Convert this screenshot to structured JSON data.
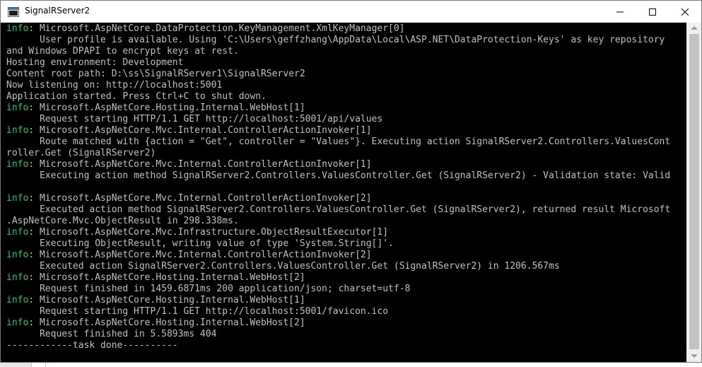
{
  "window": {
    "title": "SignalRServer2"
  },
  "icons": {
    "app": "console-app-icon",
    "minimize": "minimize-icon",
    "maximize": "maximize-icon",
    "close": "close-icon"
  },
  "colors": {
    "console_background": "#000000",
    "console_text": "#c0c0c0",
    "info_level": "#00d36b"
  },
  "console": {
    "lines": [
      {
        "level": "info",
        "text": ": Microsoft.AspNetCore.DataProtection.KeyManagement.XmlKeyManager[0]"
      },
      {
        "level": "",
        "text": "      User profile is available. Using 'C:\\Users\\geffzhang\\AppData\\Local\\ASP.NET\\DataProtection-Keys' as key repository"
      },
      {
        "level": "",
        "text": "and Windows DPAPI to encrypt keys at rest."
      },
      {
        "level": "",
        "text": "Hosting environment: Development"
      },
      {
        "level": "",
        "text": "Content root path: D:\\ss\\SignalRServer1\\SignalRServer2"
      },
      {
        "level": "",
        "text": "Now listening on: http://localhost:5001"
      },
      {
        "level": "",
        "text": "Application started. Press Ctrl+C to shut down."
      },
      {
        "level": "info",
        "text": ": Microsoft.AspNetCore.Hosting.Internal.WebHost[1]"
      },
      {
        "level": "",
        "text": "      Request starting HTTP/1.1 GET http://localhost:5001/api/values"
      },
      {
        "level": "info",
        "text": ": Microsoft.AspNetCore.Mvc.Internal.ControllerActionInvoker[1]"
      },
      {
        "level": "",
        "text": "      Route matched with {action = \"Get\", controller = \"Values\"}. Executing action SignalRServer2.Controllers.ValuesCont"
      },
      {
        "level": "",
        "text": "roller.Get (SignalRServer2)"
      },
      {
        "level": "info",
        "text": ": Microsoft.AspNetCore.Mvc.Internal.ControllerActionInvoker[1]"
      },
      {
        "level": "",
        "text": "      Executing action method SignalRServer2.Controllers.ValuesController.Get (SignalRServer2) - Validation state: Valid"
      },
      {
        "level": "",
        "text": ""
      },
      {
        "level": "info",
        "text": ": Microsoft.AspNetCore.Mvc.Internal.ControllerActionInvoker[2]"
      },
      {
        "level": "",
        "text": "      Executed action method SignalRServer2.Controllers.ValuesController.Get (SignalRServer2), returned result Microsoft"
      },
      {
        "level": "",
        "text": ".AspNetCore.Mvc.ObjectResult in 298.338ms."
      },
      {
        "level": "info",
        "text": ": Microsoft.AspNetCore.Mvc.Infrastructure.ObjectResultExecutor[1]"
      },
      {
        "level": "",
        "text": "      Executing ObjectResult, writing value of type 'System.String[]'."
      },
      {
        "level": "info",
        "text": ": Microsoft.AspNetCore.Mvc.Internal.ControllerActionInvoker[2]"
      },
      {
        "level": "",
        "text": "      Executed action SignalRServer2.Controllers.ValuesController.Get (SignalRServer2) in 1206.567ms"
      },
      {
        "level": "info",
        "text": ": Microsoft.AspNetCore.Hosting.Internal.WebHost[2]"
      },
      {
        "level": "",
        "text": "      Request finished in 1459.6871ms 200 application/json; charset=utf-8"
      },
      {
        "level": "info",
        "text": ": Microsoft.AspNetCore.Hosting.Internal.WebHost[1]"
      },
      {
        "level": "",
        "text": "      Request starting HTTP/1.1 GET http://localhost:5001/favicon.ico"
      },
      {
        "level": "info",
        "text": ": Microsoft.AspNetCore.Hosting.Internal.WebHost[2]"
      },
      {
        "level": "",
        "text": "      Request finished in 5.5893ms 404"
      },
      {
        "level": "",
        "text": "------------task done----------"
      }
    ]
  }
}
